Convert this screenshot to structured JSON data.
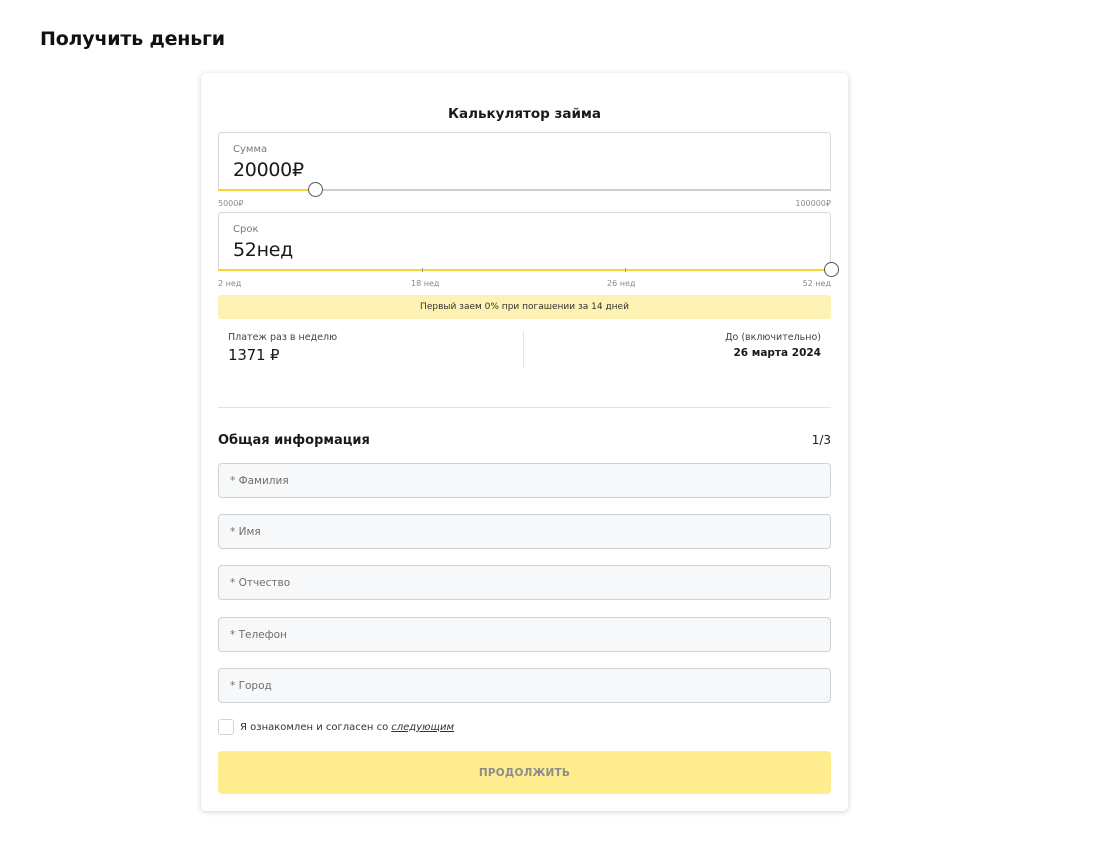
{
  "page": {
    "title": "Получить деньги"
  },
  "calculator": {
    "title": "Калькулятор займа",
    "amount": {
      "label": "Сумма",
      "value": "20000",
      "unit": "₽",
      "min_label": "5000₽",
      "max_label": "100000₽",
      "min": 5000,
      "max": 100000,
      "current": 20000
    },
    "term": {
      "label": "Срок",
      "value": "52",
      "unit": "нед",
      "tick_labels": [
        "2 нед",
        "18 нед",
        "26 нед",
        "52 нед"
      ],
      "min": 2,
      "max": 52,
      "current": 52
    },
    "promo": "Первый заем 0% при погашении за 14 дней",
    "payment": {
      "label": "Платеж раз в неделю",
      "value": "1371 ₽"
    },
    "due": {
      "label": "До (включительно)",
      "value": "26 марта 2024"
    }
  },
  "form": {
    "section_title": "Общая информация",
    "step": "1/3",
    "fields": {
      "last_name": {
        "placeholder": "* Фамилия",
        "value": ""
      },
      "first_name": {
        "placeholder": "* Имя",
        "value": ""
      },
      "patronymic": {
        "placeholder": "* Отчество",
        "value": ""
      },
      "phone": {
        "placeholder": "* Телефон",
        "value": ""
      },
      "city": {
        "placeholder": "* Город",
        "value": ""
      }
    },
    "consent": {
      "text": "Я ознакомлен и согласен со",
      "link": "следующим",
      "checked": false
    },
    "submit_label": "ПРОДОЛЖИТЬ"
  },
  "colors": {
    "accent": "#f3d83a",
    "promo_bg": "#fdf1b3",
    "button_bg": "#ffec8f"
  }
}
